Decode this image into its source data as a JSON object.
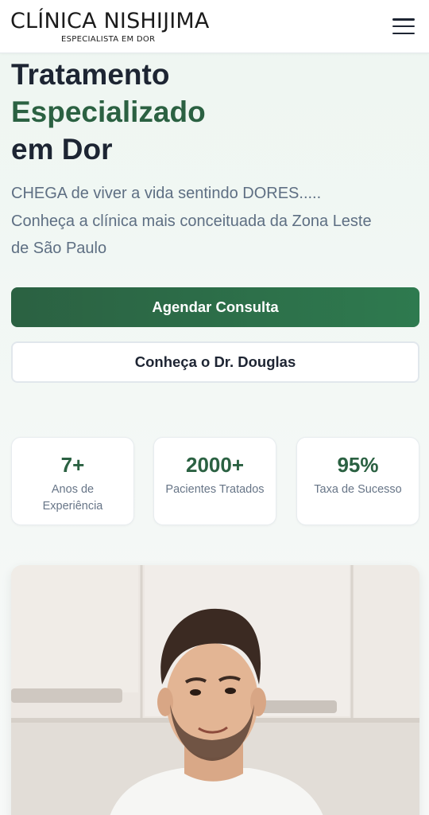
{
  "header": {
    "logo_main": "CLÍNICA NISHIJIMA",
    "logo_sub": "ESPECIALISTA EM DOR",
    "menu_icon": "hamburger-menu-icon"
  },
  "hero": {
    "title_line1": "Tratamento",
    "title_line2": "Especializado",
    "title_line3": "em Dor",
    "text_line1": "CHEGA de viver a vida sentindo DORES.....",
    "text_line2": "Conheça a clínica mais conceituada da Zona Leste",
    "text_line3": "de São Paulo"
  },
  "buttons": {
    "primary": "Agendar Consulta",
    "secondary": "Conheça o Dr. Douglas"
  },
  "stats": [
    {
      "value": "7+",
      "label": "Anos de Experiência"
    },
    {
      "value": "2000+",
      "label": "Pacientes Tratados"
    },
    {
      "value": "95%",
      "label": "Taxa de Sucesso"
    }
  ],
  "colors": {
    "brand_green": "#2b6142",
    "brand_green_light": "#2e7a4f",
    "heading_dark": "#1d2533",
    "body_text": "#5e6f83"
  }
}
